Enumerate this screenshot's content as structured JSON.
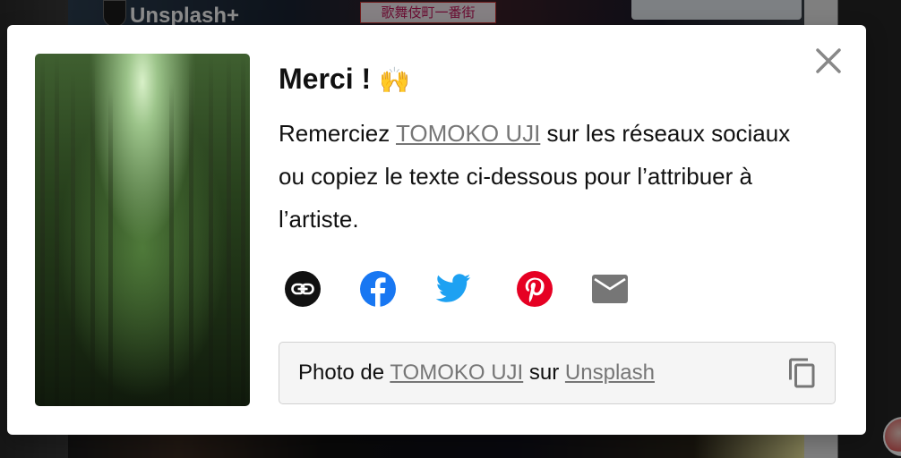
{
  "background": {
    "brand_text": "Unsplash+",
    "sign_text": "歌舞伎町一番街"
  },
  "modal": {
    "title": "Merci !",
    "title_emoji": "🙌",
    "description_before": "Remerciez ",
    "photographer": "TOMOKO UJI",
    "description_after": " sur les réseaux sociaux ou copiez le texte ci-dessous pour l’attribuer à l’artiste.",
    "share_icons": [
      "link-icon",
      "facebook-icon",
      "twitter-icon",
      "pinterest-icon",
      "email-icon"
    ],
    "citation": {
      "prefix": "Photo de ",
      "photographer": "TOMOKO UJI",
      "middle": " sur ",
      "site": "Unsplash"
    },
    "close_icon": "close-icon",
    "copy_icon": "copy-icon"
  },
  "colors": {
    "facebook": "#1877F2",
    "twitter": "#1DA1F2",
    "pinterest": "#E60023",
    "email": "#767676",
    "link": "#111111"
  }
}
